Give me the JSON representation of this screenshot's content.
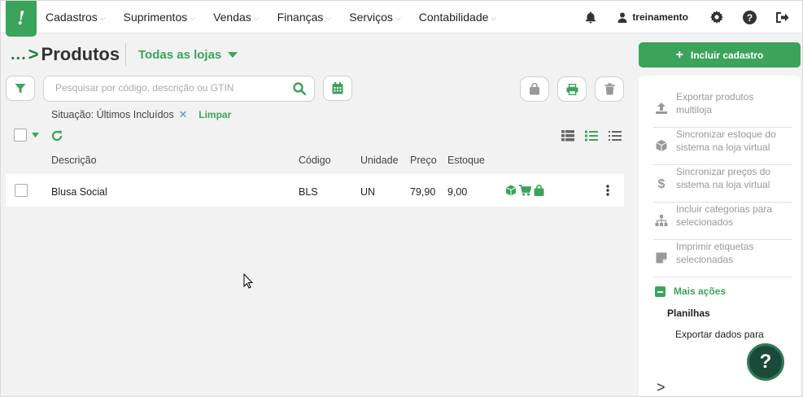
{
  "nav": {
    "logo_glyph": "!",
    "items": [
      {
        "label": "Cadastros"
      },
      {
        "label": "Suprimentos"
      },
      {
        "label": "Vendas"
      },
      {
        "label": "Finanças"
      },
      {
        "label": "Serviços"
      },
      {
        "label": "Contabilidade"
      }
    ],
    "user": "treinamento"
  },
  "header": {
    "breadcrumb_dots": "...",
    "breadcrumb_arrow": ">",
    "title": "Produtos",
    "store_selector": "Todas as lojas"
  },
  "search": {
    "placeholder": "Pesquisar por código, descrição ou GTIN",
    "value": ""
  },
  "filter": {
    "label": "Situação: Últimos Incluídos",
    "remove": "✕",
    "clear": "Limpar"
  },
  "table": {
    "columns": [
      "Descrição",
      "Código",
      "Unidade",
      "Preço",
      "Estoque"
    ],
    "rows": [
      {
        "descricao": "Blusa Social",
        "codigo": "BLS",
        "unidade": "UN",
        "preco": "79,90",
        "estoque": "9,00"
      }
    ]
  },
  "sidebar": {
    "primary_label": "Incluir cadastro",
    "actions": [
      {
        "label": "Exportar produtos multiloja",
        "icon": "upload-icon"
      },
      {
        "label": "Sincronizar estoque do sistema na loja virtual",
        "icon": "box-icon"
      },
      {
        "label": "Sincronizar preços do sistema na loja virtual",
        "icon": "dollar-icon"
      },
      {
        "label": "Incluir categorias para selecionados",
        "icon": "sitemap-icon"
      },
      {
        "label": "Imprimir etiquetas selecionadas",
        "icon": "label-icon"
      }
    ],
    "more_actions": "Mais ações",
    "section": "Planilhas",
    "export_label": "Exportar dados para",
    "collapse": ">"
  },
  "help_fab": "?",
  "colors": {
    "brand": "#3ca35b",
    "dark_green": "#1c4a3a",
    "muted": "#999999"
  }
}
